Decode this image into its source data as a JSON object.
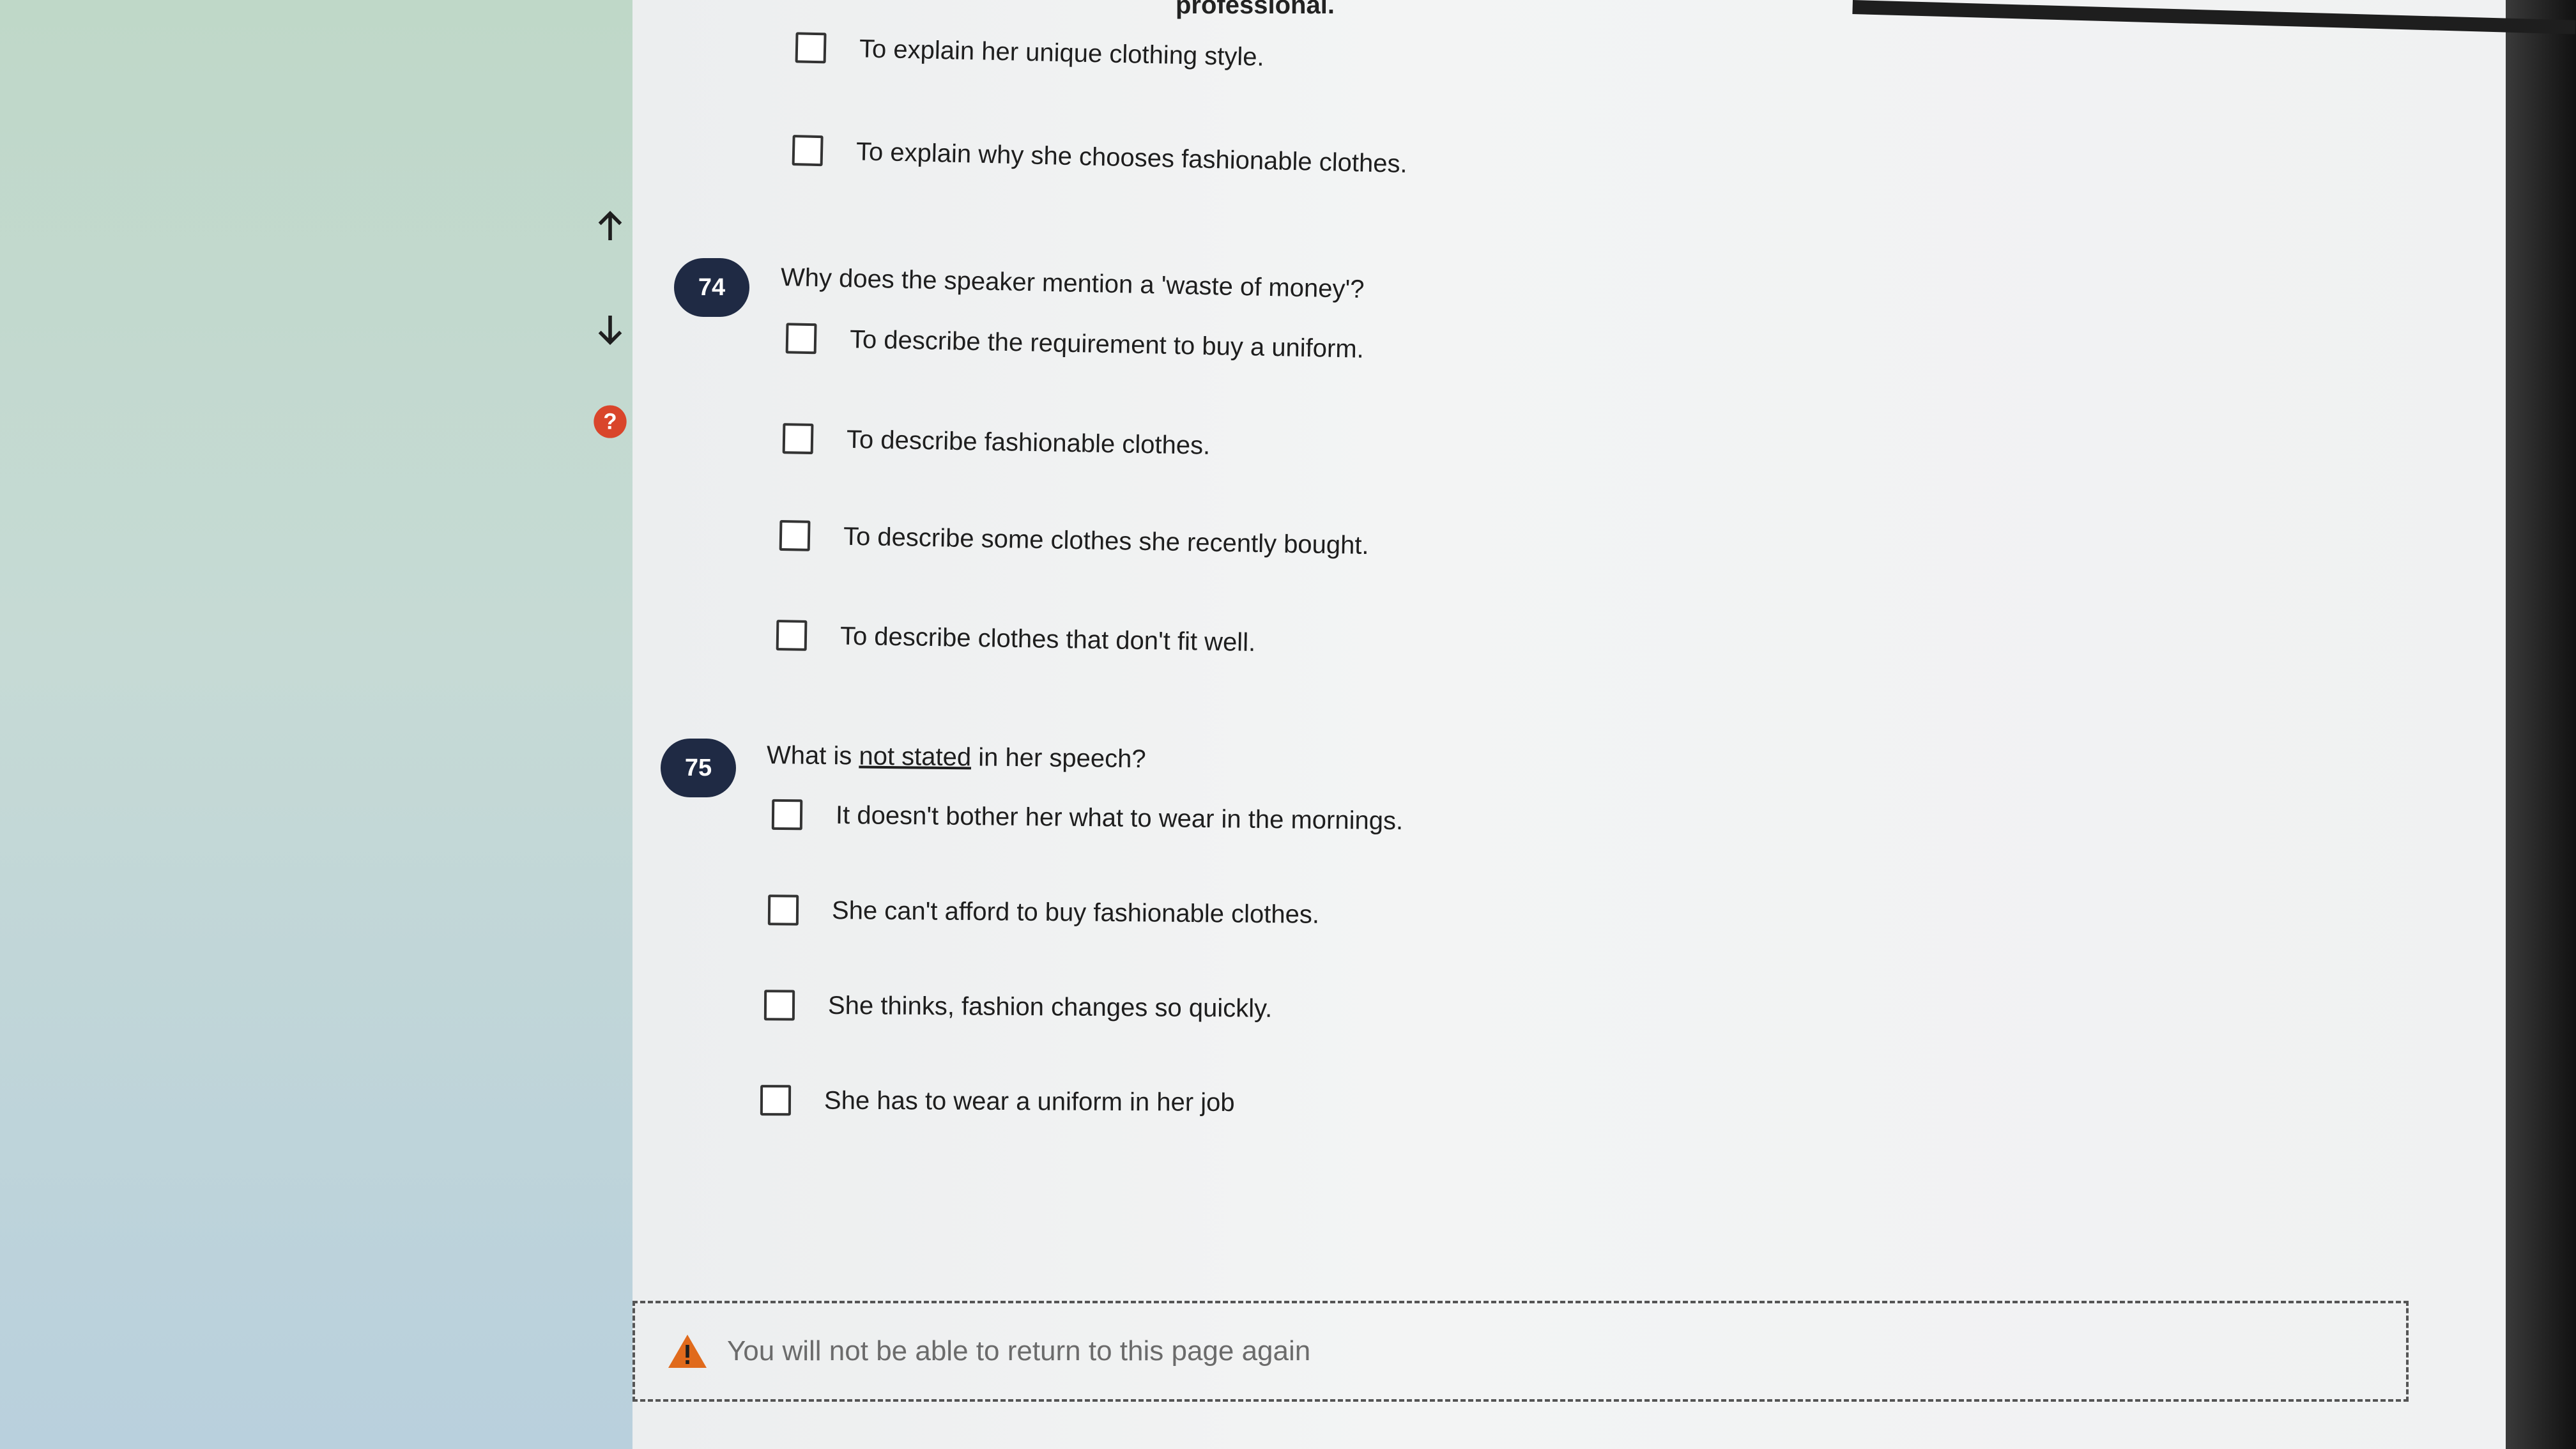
{
  "top_fragment": "professional.",
  "prev_options": [
    "To explain her unique clothing style.",
    "To explain why she chooses fashionable clothes."
  ],
  "nav": {
    "up_icon": "arrow-up-icon",
    "down_icon": "arrow-down-icon",
    "help_icon": "help-icon",
    "help_color": "#d9452b"
  },
  "questions": [
    {
      "number": "74",
      "text": "Why does the speaker mention a 'waste of money'?",
      "options": [
        "To describe the requirement to buy a uniform.",
        "To describe fashionable clothes.",
        "To describe some clothes she recently bought.",
        "To describe clothes that don't fit well."
      ]
    },
    {
      "number": "75",
      "text_before": "What is ",
      "text_underlined": "not stated",
      "text_after": " in her speech?",
      "options": [
        "It doesn't bother her what to wear in the mornings.",
        "She can't afford to buy fashionable clothes.",
        "She thinks, fashion changes so quickly.",
        "She has to wear a uniform in her job"
      ]
    }
  ],
  "warning": {
    "icon": "warning-triangle-icon",
    "text": "You will not be able to return to this page again",
    "color": "#e06a1c"
  },
  "colors": {
    "question_badge": "#1f2a44"
  }
}
